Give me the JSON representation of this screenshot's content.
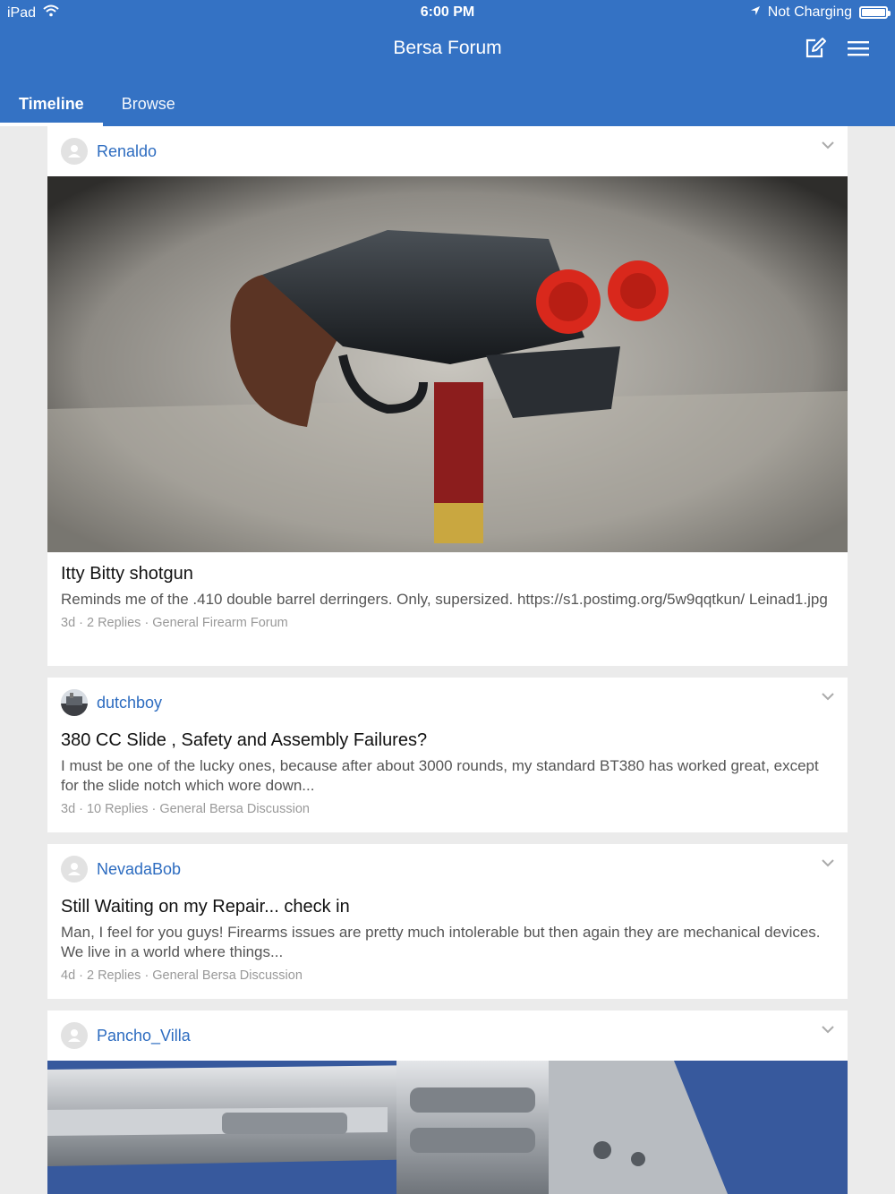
{
  "status_bar": {
    "device": "iPad",
    "time": "6:00 PM",
    "charging": "Not Charging"
  },
  "header": {
    "title": "Bersa Forum",
    "tabs": [
      {
        "label": "Timeline",
        "active": true
      },
      {
        "label": "Browse",
        "active": false
      }
    ]
  },
  "posts": [
    {
      "author": "Renaldo",
      "title": "Itty Bitty shotgun",
      "excerpt": "Reminds me of the .410 double barrel derringers. Only, supersized. https://s1.postimg.org/5w9qqtkun/ Leinad1.jpg",
      "age": "3d",
      "replies": "2 Replies",
      "forum": "General Firearm Forum",
      "image": "derringer-shotgun-photo"
    },
    {
      "author": "dutchboy",
      "title": "380 CC Slide , Safety and Assembly Failures?",
      "excerpt": "I must be one of the lucky ones, because after about 3000 rounds, my standard BT380 has worked great, except for the slide notch which wore down...",
      "age": "3d",
      "replies": "10 Replies",
      "forum": "General Bersa Discussion"
    },
    {
      "author": "NevadaBob",
      "title": "Still Waiting on my Repair... check in",
      "excerpt": "Man, I feel for you guys! Firearms issues are pretty much intolerable but then again they are mechanical devices. We live in a world where things...",
      "age": "4d",
      "replies": "2 Replies",
      "forum": "General Bersa Discussion"
    },
    {
      "author": "Pancho_Villa",
      "image": "revolver-photo"
    }
  ],
  "colors": {
    "header_bg": "#3472c4",
    "author_link": "#2d6cc0"
  }
}
